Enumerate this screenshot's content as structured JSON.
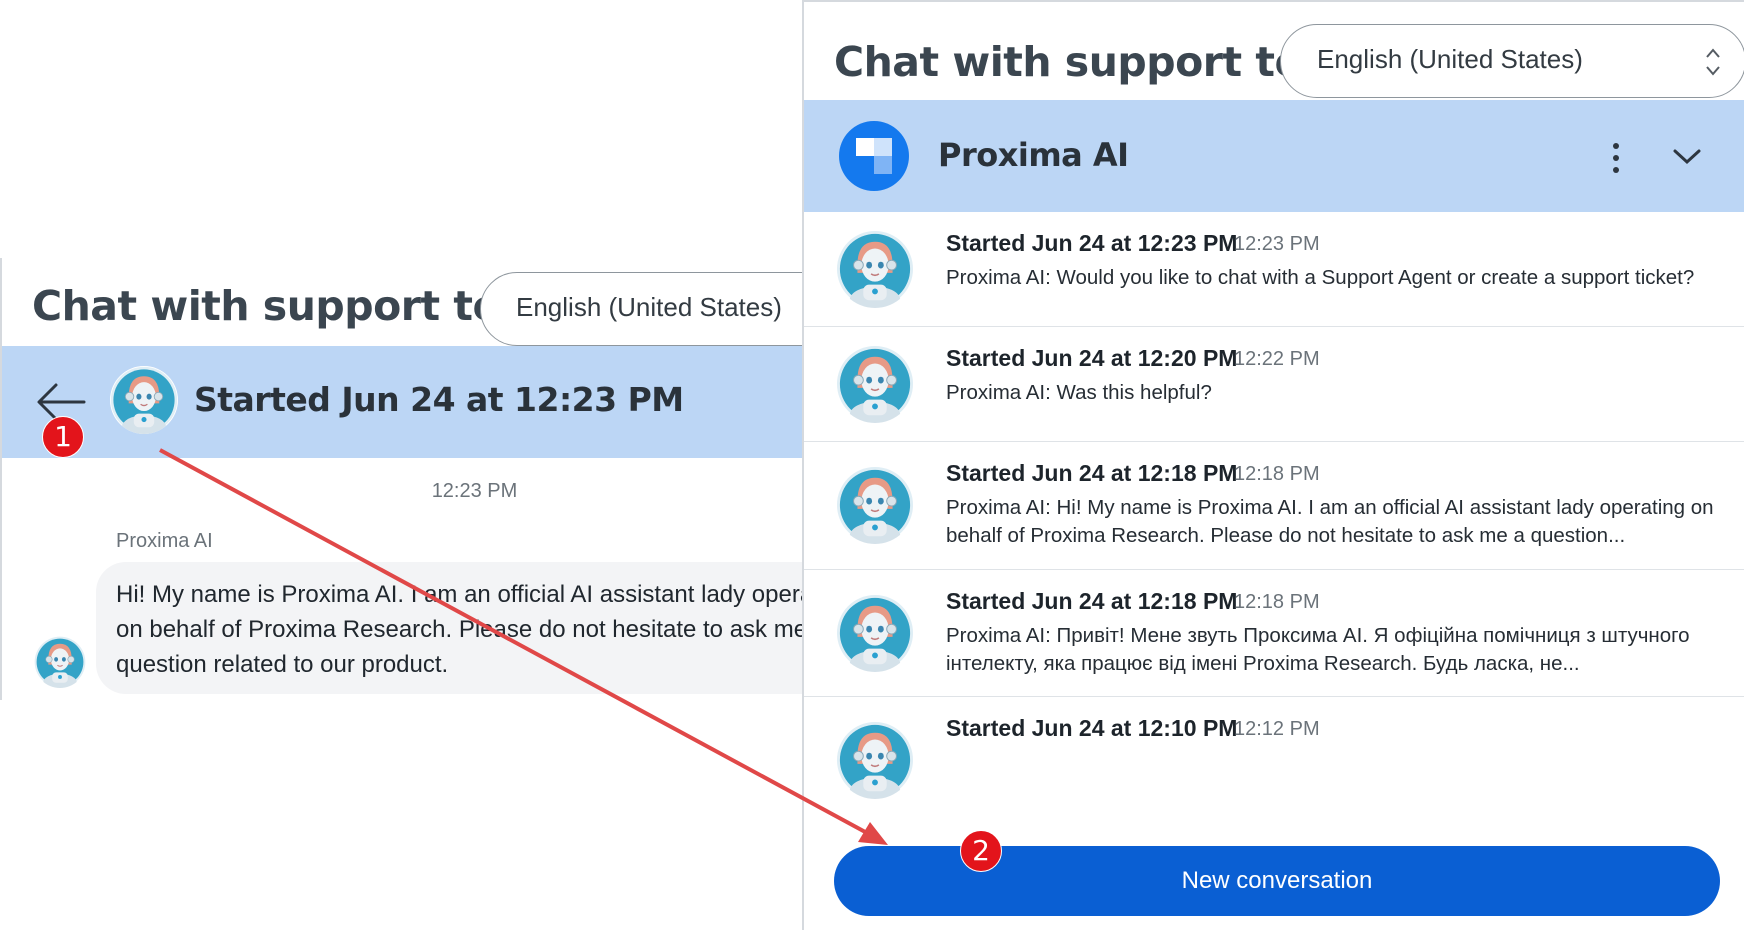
{
  "left": {
    "title": "Chat with support te...",
    "language": "English (United States)",
    "conversation_title": "Started Jun 24 at 12:23 PM",
    "message_time": "12:23 PM",
    "sender": "Proxima AI",
    "message": "Hi! My name is Proxima AI. I am an official AI assistant lady operating on behalf of Proxima Research. Please do not hesitate to ask me a question related to our product."
  },
  "right": {
    "title": "Chat with support te...",
    "language": "English (United States)",
    "brand_name": "Proxima AI",
    "conversations": [
      {
        "title": "Started Jun 24 at 12:23 PM",
        "time": "12:23 PM",
        "preview": "Proxima AI: Would you like to chat with a Support Agent or create a support ticket?"
      },
      {
        "title": "Started Jun 24 at 12:20 PM",
        "time": "12:22 PM",
        "preview": "Proxima AI: Was this helpful?"
      },
      {
        "title": "Started Jun 24 at 12:18 PM",
        "time": "12:18 PM",
        "preview": "Proxima AI: Hi! My name is Proxima AI. I am an official AI assistant lady operating on behalf of Proxima Research. Please do not hesitate to ask me a question..."
      },
      {
        "title": "Started Jun 24 at 12:18 PM",
        "time": "12:18 PM",
        "preview": "Proxima AI: Привіт! Мене звуть Проксима AI. Я офіційна помічниця з штучного інтелекту, яка працює від імені Proxima Research. Будь ласка, не..."
      },
      {
        "title": "Started Jun 24 at 12:10 PM",
        "time": "12:12 PM",
        "preview": ""
      }
    ],
    "new_conversation_label": "New conversation"
  },
  "annotations": {
    "badge_1": "1",
    "badge_2": "2",
    "arrow_color": "#e04848",
    "badge_color": "#e3141b"
  },
  "colors": {
    "header_band": "#bcd6f5",
    "primary_button": "#0a5fd3"
  }
}
